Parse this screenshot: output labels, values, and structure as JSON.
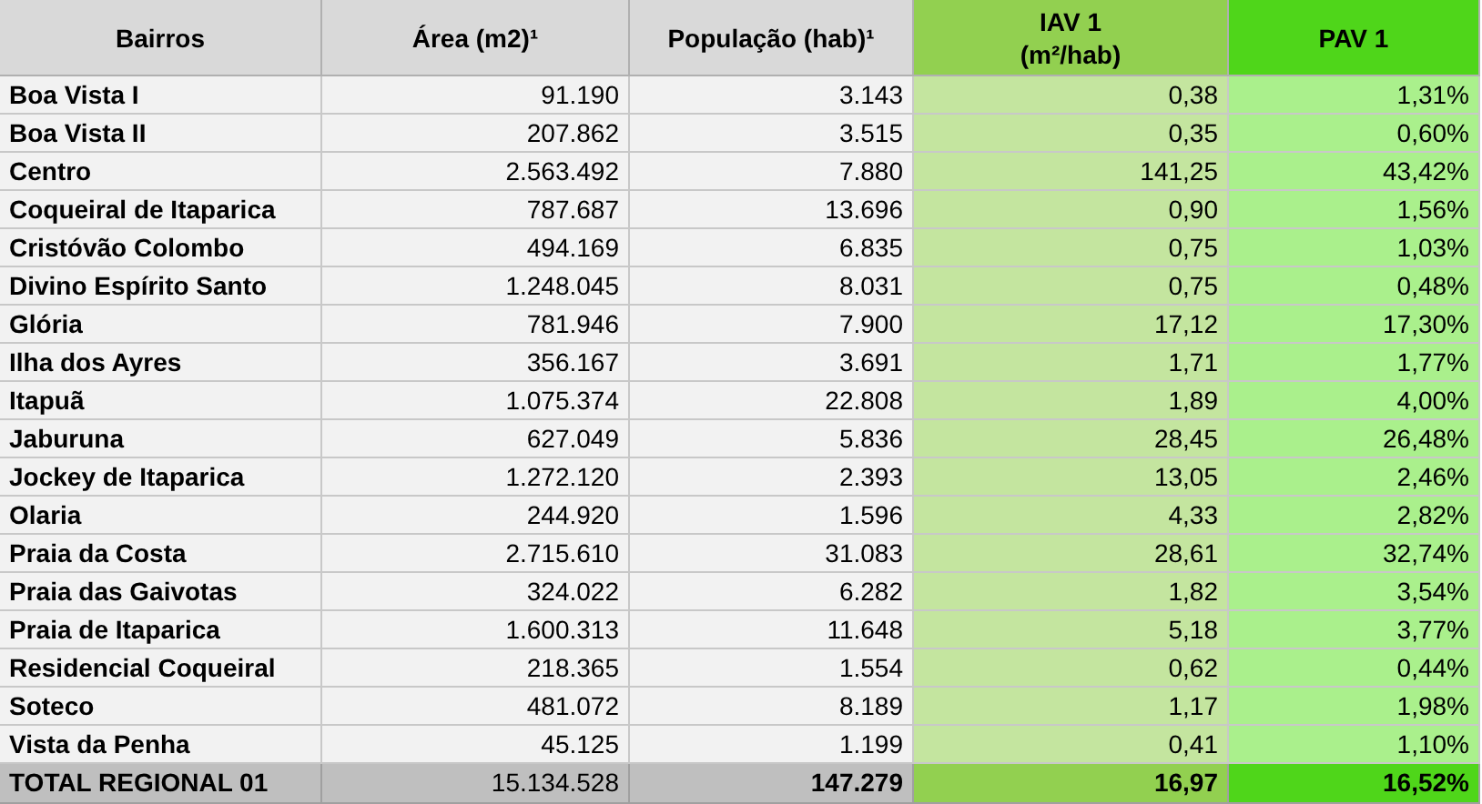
{
  "columns": [
    {
      "label": "Bairros"
    },
    {
      "label": "Área (m2)¹"
    },
    {
      "label": "População (hab)¹"
    },
    {
      "label": "IAV 1\n(m²/hab)"
    },
    {
      "label": "PAV 1"
    }
  ],
  "rows": [
    [
      "Boa Vista I",
      "91.190",
      "3.143",
      "0,38",
      "1,31%"
    ],
    [
      "Boa Vista II",
      "207.862",
      "3.515",
      "0,35",
      "0,60%"
    ],
    [
      "Centro",
      "2.563.492",
      "7.880",
      "141,25",
      "43,42%"
    ],
    [
      "Coqueiral de Itaparica",
      "787.687",
      "13.696",
      "0,90",
      "1,56%"
    ],
    [
      "Cristóvão Colombo",
      "494.169",
      "6.835",
      "0,75",
      "1,03%"
    ],
    [
      "Divino Espírito Santo",
      "1.248.045",
      "8.031",
      "0,75",
      "0,48%"
    ],
    [
      "Glória",
      "781.946",
      "7.900",
      "17,12",
      "17,30%"
    ],
    [
      "Ilha dos Ayres",
      "356.167",
      "3.691",
      "1,71",
      "1,77%"
    ],
    [
      "Itapuã",
      "1.075.374",
      "22.808",
      "1,89",
      "4,00%"
    ],
    [
      "Jaburuna",
      "627.049",
      "5.836",
      "28,45",
      "26,48%"
    ],
    [
      "Jockey de Itaparica",
      "1.272.120",
      "2.393",
      "13,05",
      "2,46%"
    ],
    [
      "Olaria",
      "244.920",
      "1.596",
      "4,33",
      "2,82%"
    ],
    [
      "Praia da Costa",
      "2.715.610",
      "31.083",
      "28,61",
      "32,74%"
    ],
    [
      "Praia das Gaivotas",
      "324.022",
      "6.282",
      "1,82",
      "3,54%"
    ],
    [
      "Praia de Itaparica",
      "1.600.313",
      "11.648",
      "5,18",
      "3,77%"
    ],
    [
      "Residencial Coqueiral",
      "218.365",
      "1.554",
      "0,62",
      "0,44%"
    ],
    [
      "Soteco",
      "481.072",
      "8.189",
      "1,17",
      "1,98%"
    ],
    [
      "Vista da Penha",
      "45.125",
      "1.199",
      "0,41",
      "1,10%"
    ]
  ],
  "total": [
    {
      "text": "TOTAL REGIONAL 01",
      "bold": true
    },
    {
      "text": "15.134.528",
      "bold": false
    },
    {
      "text": "147.279",
      "bold": true
    },
    {
      "text": "16,97",
      "bold": true
    },
    {
      "text": "16,52%",
      "bold": true
    }
  ]
}
